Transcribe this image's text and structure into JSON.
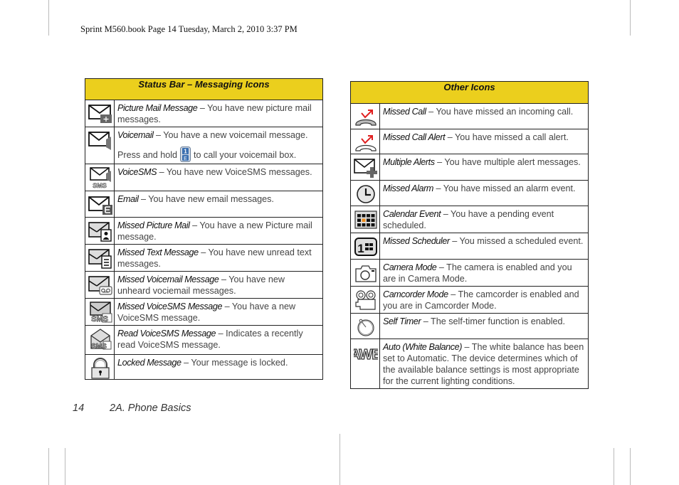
{
  "slug": "Sprint M560.book  Page 14  Tuesday, March 2, 2010  3:37 PM",
  "footer": {
    "page_number": "14",
    "section": "2A. Phone Basics"
  },
  "left_table": {
    "title": "Status Bar – Messaging Icons",
    "rows": [
      {
        "icon": "picture-mail-icon",
        "term": "Picture Mail Message",
        "desc": " – You have new picture mail messages."
      },
      {
        "icon": "voicemail-icon",
        "term": "Voicemail",
        "desc": " – You have a new voicemail message.",
        "line2_pre": "Press and hold",
        "line2_key": "1-key-icon",
        "line2_post": "to call your voicemail box."
      },
      {
        "icon": "voicesms-icon",
        "term": "VoiceSMS",
        "desc": " – You have new VoiceSMS messages."
      },
      {
        "icon": "email-icon",
        "term": "Email",
        "desc": " – You have new email messages."
      },
      {
        "icon": "missed-picture-mail-icon",
        "term": "Missed Picture Mail",
        "desc": " – You have a new Picture mail message."
      },
      {
        "icon": "missed-text-message-icon",
        "term": "Missed Text Message",
        "desc": " – You have new unread text messages."
      },
      {
        "icon": "missed-voicemail-icon",
        "term": "Missed Voicemail Message",
        "desc": " – You have new unheard vociemail messages."
      },
      {
        "icon": "missed-voicesms-icon",
        "term": "Missed VoiceSMS Message",
        "desc": " – You have a new VoiceSMS message."
      },
      {
        "icon": "read-voicesms-icon",
        "term": "Read VoiceSMS Message",
        "desc": " – Indicates a recently read VoiceSMS message."
      },
      {
        "icon": "locked-message-icon",
        "term": "Locked Message",
        "desc": " – Your message is locked."
      }
    ]
  },
  "right_table": {
    "title": "Other Icons",
    "rows": [
      {
        "icon": "missed-call-icon",
        "term": "Missed Call",
        "desc": " – You have missed an incoming call."
      },
      {
        "icon": "missed-call-alert-icon",
        "term": "Missed Call Alert",
        "desc": " – You have missed a call alert."
      },
      {
        "icon": "multiple-alerts-icon",
        "term": "Multiple Alerts",
        "desc": " – You have multiple alert messages."
      },
      {
        "icon": "missed-alarm-icon",
        "term": "Missed Alarm",
        "desc": " – You have missed an alarm event."
      },
      {
        "icon": "calendar-event-icon",
        "term": "Calendar Event",
        "desc": " – You have a pending event scheduled."
      },
      {
        "icon": "missed-scheduler-icon",
        "term": "Missed Scheduler",
        "desc": " – You missed a scheduled event."
      },
      {
        "icon": "camera-mode-icon",
        "term": "Camera Mode",
        "desc": " – The camera is enabled and you are in Camera Mode."
      },
      {
        "icon": "camcorder-mode-icon",
        "term": "Camcorder Mode",
        "desc": " – The camcorder is enabled and you are in Camcorder Mode."
      },
      {
        "icon": "self-timer-icon",
        "term": "Self Timer",
        "desc": " – The self-timer function is enabled."
      },
      {
        "icon": "auto-white-balance-icon",
        "term": "Auto (White Balance)",
        "desc": " – The white balance has been set to Automatic. The device determines which of the available balance settings is most appropriate for the current lighting conditions.",
        "icon_text": "AWB"
      }
    ]
  },
  "colors": {
    "header_fill": "#ebcf1d",
    "missed_arrow": "#e02020",
    "calendar_highlight": "#f08c1a",
    "voicemail_key": "#3a6fb0"
  }
}
